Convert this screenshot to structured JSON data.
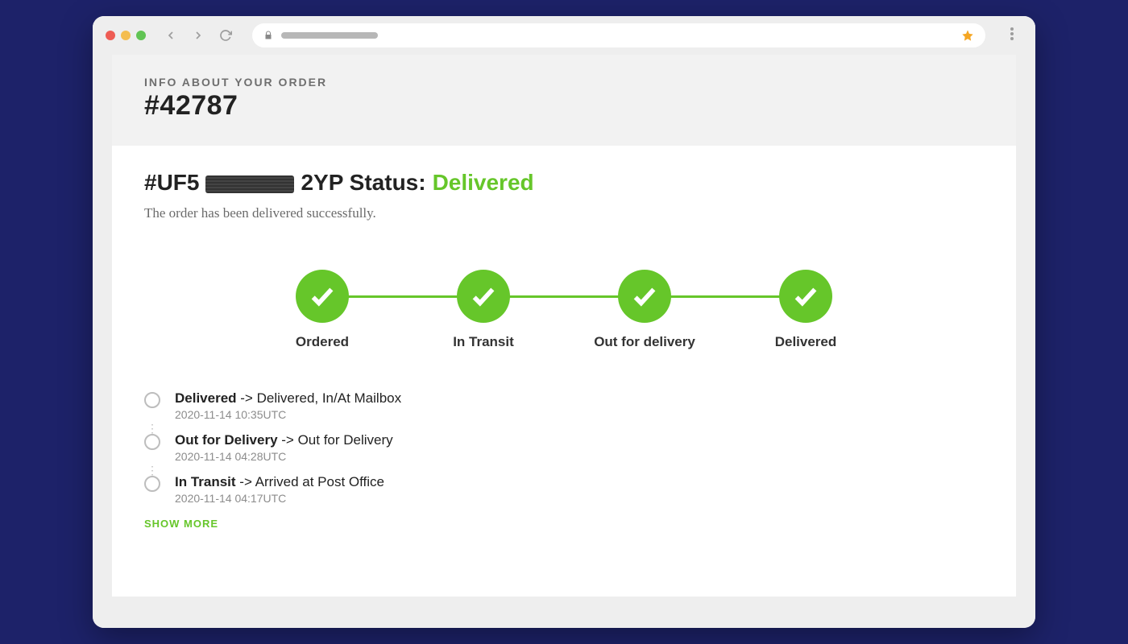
{
  "header": {
    "info_label": "INFO ABOUT YOUR ORDER",
    "order_number": "#42787"
  },
  "status": {
    "prefix": "#UF5",
    "suffix": "2YP Status:",
    "value": "Delivered",
    "description": "The order has been delivered successfully."
  },
  "steps": [
    {
      "label": "Ordered",
      "done": true
    },
    {
      "label": "In Transit",
      "done": true
    },
    {
      "label": "Out for delivery",
      "done": true
    },
    {
      "label": "Delivered",
      "done": true
    }
  ],
  "timeline": [
    {
      "title": "Delivered",
      "detail": " -> Delivered, In/At Mailbox",
      "time": "2020-11-14 10:35UTC"
    },
    {
      "title": "Out for Delivery",
      "detail": " -> Out for Delivery",
      "time": "2020-11-14 04:28UTC"
    },
    {
      "title": "In Transit",
      "detail": " -> Arrived at Post Office",
      "time": "2020-11-14 04:17UTC"
    }
  ],
  "show_more": "SHOW MORE",
  "colors": {
    "accent": "#66c62a"
  }
}
